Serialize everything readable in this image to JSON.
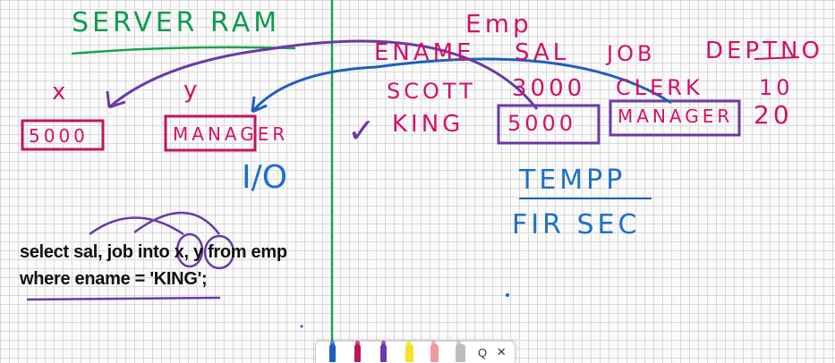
{
  "server": {
    "title": "SERVER RAM",
    "var_x": "x",
    "var_y": "y",
    "x_value": "5000",
    "y_value": "MANAGER"
  },
  "emp": {
    "table_name": "Emp",
    "columns": [
      "ENAME",
      "SAL",
      "JOB",
      "DEPTNO"
    ],
    "rows": [
      {
        "ename": "SCOTT",
        "sal": "3000",
        "job": "CLERK",
        "deptno": "10"
      },
      {
        "ename": "KING",
        "sal": "5000",
        "job": "MANAGER",
        "deptno": "20"
      }
    ],
    "checkmark": "✓"
  },
  "notes": {
    "io": "I/O",
    "tempp": "TEMPP",
    "fir_sec": "FIR SEC"
  },
  "query": {
    "line1": "select sal, job into x, y from emp",
    "line2": "where ename = 'KING';"
  },
  "toolbar": {
    "pens": [
      {
        "name": "blue-pen",
        "color": "#1f5fbf"
      },
      {
        "name": "magenta-pen",
        "color": "#c0155f"
      },
      {
        "name": "purple-pen",
        "color": "#6a3aa8"
      },
      {
        "name": "yellow-highlighter",
        "color": "#f3e32a"
      },
      {
        "name": "pink-highlighter",
        "color": "#f19aa0"
      },
      {
        "name": "eraser",
        "color": "#bdbdbd"
      }
    ],
    "lasso_icon": "Q",
    "close_icon": "✕"
  }
}
